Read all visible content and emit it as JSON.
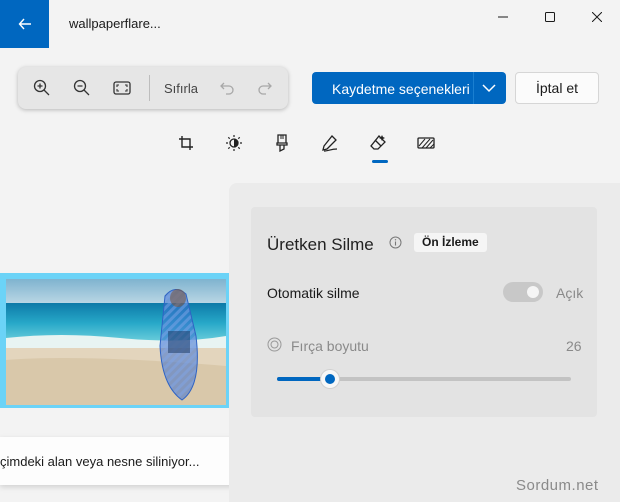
{
  "window": {
    "title": "wallpaperflare..."
  },
  "zoombar": {
    "reset_label": "Sıfırla"
  },
  "actions": {
    "save_label": "Kaydetme seçenekleri",
    "cancel_label": "İptal et"
  },
  "tools": [
    "crop-icon",
    "brightness-icon",
    "marker-icon",
    "pen-icon",
    "eraser-icon",
    "background-icon"
  ],
  "toast": {
    "text": "çimdeki alan veya nesne siliniyor..."
  },
  "panel": {
    "title": "Üretken Silme",
    "badge": "Ön İzleme",
    "auto_erase_label": "Otomatik silme",
    "auto_erase_state": "Açık",
    "brush_size_label": "Fırça boyutu",
    "brush_size_value": "26",
    "brush_size_fraction": 0.18
  },
  "watermark": "Sordum.net",
  "colors": {
    "accent": "#0067c0",
    "image_border": "#6bd3f7"
  }
}
